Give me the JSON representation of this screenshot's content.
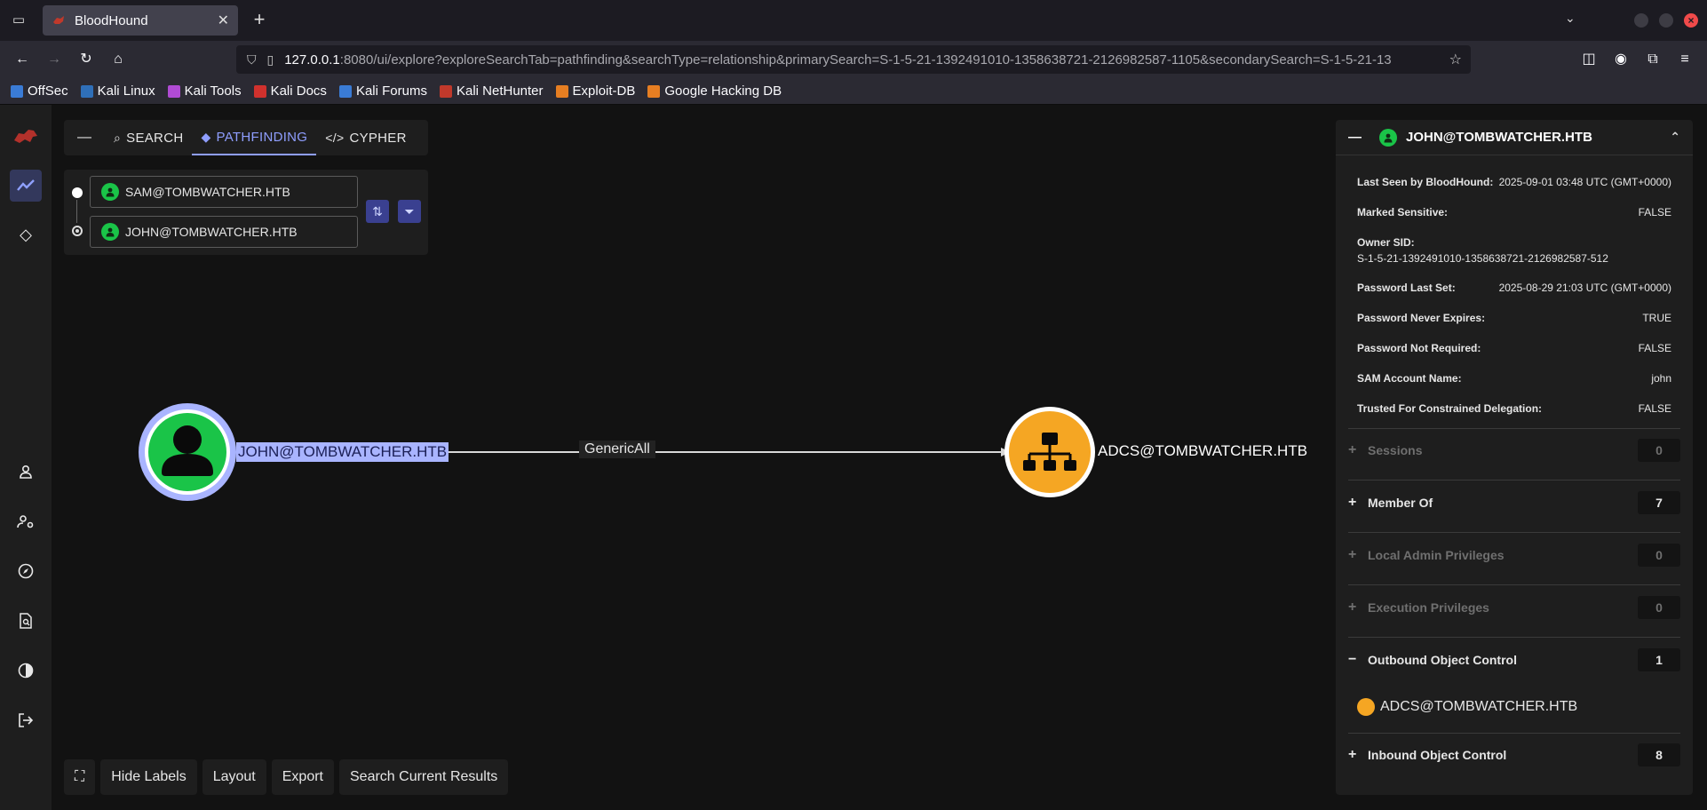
{
  "browser": {
    "tab_title": "BloodHound",
    "url_host": "127.0.0.1",
    "url_path": ":8080/ui/explore?exploreSearchTab=pathfinding&searchType=relationship&primarySearch=S-1-5-21-1392491010-1358638721-2126982587-1105&secondarySearch=S-1-5-21-13",
    "bookmarks": [
      "OffSec",
      "Kali Linux",
      "Kali Tools",
      "Kali Docs",
      "Kali Forums",
      "Kali NetHunter",
      "Exploit-DB",
      "Google Hacking DB"
    ]
  },
  "explore": {
    "tabs": [
      "SEARCH",
      "PATHFINDING",
      "CYPHER"
    ],
    "active_tab": "PATHFINDING",
    "start_node": "SAM@TOMBWATCHER.HTB",
    "end_node": "JOHN@TOMBWATCHER.HTB"
  },
  "graph": {
    "source_label": "JOHN@TOMBWATCHER.HTB",
    "edge_label": "GenericAll",
    "target_label": "ADCS@TOMBWATCHER.HTB",
    "source_color": "#1ac448",
    "target_color": "#f5a623"
  },
  "bottom_buttons": [
    "Hide Labels",
    "Layout",
    "Export",
    "Search Current Results"
  ],
  "panel": {
    "title": "JOHN@TOMBWATCHER.HTB",
    "properties": [
      {
        "key": "Last Seen by BloodHound:",
        "value": "2025-09-01 03:48 UTC (GMT+0000)"
      },
      {
        "key": "Marked Sensitive:",
        "value": "FALSE"
      },
      {
        "key": "Owner SID:",
        "value": "S-1-5-21-1392491010-1358638721-2126982587-512"
      },
      {
        "key": "Password Last Set:",
        "value": "2025-08-29 21:03 UTC (GMT+0000)"
      },
      {
        "key": "Password Never Expires:",
        "value": "TRUE"
      },
      {
        "key": "Password Not Required:",
        "value": "FALSE"
      },
      {
        "key": "SAM Account Name:",
        "value": "john"
      },
      {
        "key": "Trusted For Constrained Delegation:",
        "value": "FALSE"
      }
    ],
    "sections": [
      {
        "label": "Sessions",
        "count": "0",
        "sign": "+"
      },
      {
        "label": "Member Of",
        "count": "7",
        "sign": "+"
      },
      {
        "label": "Local Admin Privileges",
        "count": "0",
        "sign": "+"
      },
      {
        "label": "Execution Privileges",
        "count": "0",
        "sign": "+"
      },
      {
        "label": "Outbound Object Control",
        "count": "1",
        "sign": "−"
      },
      {
        "label": "Inbound Object Control",
        "count": "8",
        "sign": "+"
      }
    ],
    "outbound_item": "ADCS@TOMBWATCHER.HTB"
  }
}
